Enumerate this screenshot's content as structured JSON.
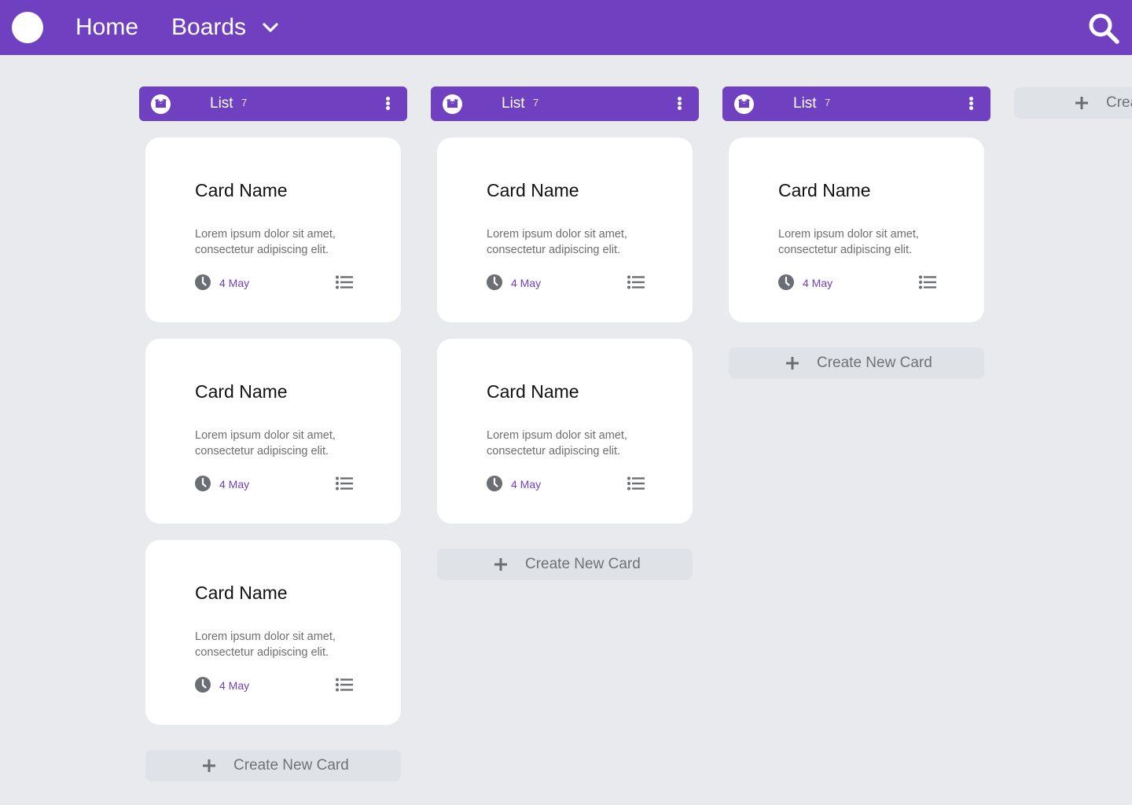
{
  "navbar": {
    "logo_icon": "circle-logo",
    "home_label": "Home",
    "boards_label": "Boards",
    "boards_icon": "chevron-down-icon",
    "search_icon": "search-icon"
  },
  "colors": {
    "brand": "#6f40bf",
    "background": "#e9eaee",
    "card": "#ffffff",
    "create_button_bg": "#dfe2e6",
    "muted_text": "#6e737a",
    "icon_gray": "#6b6f75"
  },
  "lists": [
    {
      "title": "List",
      "count": "7",
      "icon": "box-icon",
      "menu_icon": "more-vertical-icon",
      "cards": [
        {
          "title": "Card Name",
          "description": "Lorem ipsum dolor sit amet, consectetur adipiscing elit.",
          "date": "4 May"
        },
        {
          "title": "Card Name",
          "description": "Lorem ipsum dolor sit amet, consectetur adipiscing elit.",
          "date": "4 May"
        },
        {
          "title": "Card Name",
          "description": "Lorem ipsum dolor sit amet, consectetur adipiscing elit.",
          "date": "4 May"
        }
      ],
      "create_label": "Create New Card"
    },
    {
      "title": "List",
      "count": "7",
      "icon": "box-icon",
      "menu_icon": "more-vertical-icon",
      "cards": [
        {
          "title": "Card Name",
          "description": "Lorem ipsum dolor sit amet, consectetur adipiscing elit.",
          "date": "4 May"
        },
        {
          "title": "Card Name",
          "description": "Lorem ipsum dolor sit amet, consectetur adipiscing elit.",
          "date": "4 May"
        }
      ],
      "create_label": "Create New Card"
    },
    {
      "title": "List",
      "count": "7",
      "icon": "box-icon",
      "menu_icon": "more-vertical-icon",
      "cards": [
        {
          "title": "Card Name",
          "description": "Lorem ipsum dolor sit amet, consectetur adipiscing elit.",
          "date": "4 May"
        }
      ],
      "create_label": "Create New Card"
    }
  ],
  "create_list": {
    "label": "Create New List",
    "icon": "plus-icon"
  }
}
